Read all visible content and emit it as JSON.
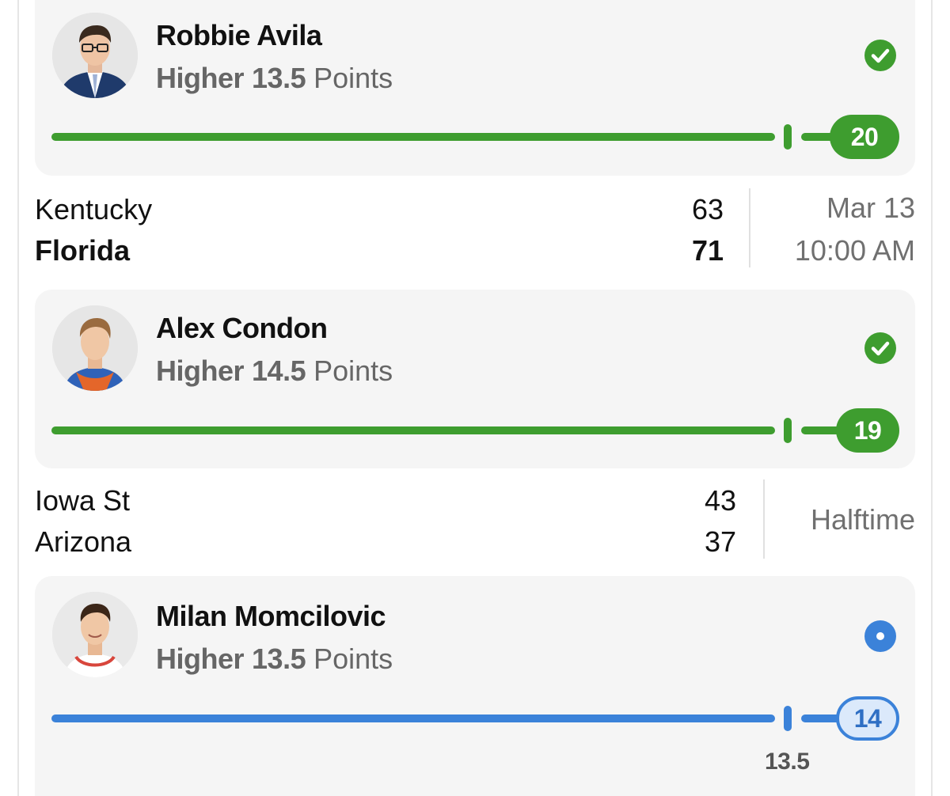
{
  "colors": {
    "success": "#3e9d2f",
    "in_progress": "#3b82d9",
    "card_bg": "#f5f5f5",
    "muted_text": "#666666"
  },
  "picks": [
    {
      "player": "Robbie Avila",
      "direction": "Higher",
      "line": "13.5",
      "stat": "Points",
      "status_icon": "check-circle-icon",
      "current_value": "20",
      "progress_fraction": 1.0
    },
    {
      "player": "Alex Condon",
      "direction": "Higher",
      "line": "14.5",
      "stat": "Points",
      "status_icon": "check-circle-icon",
      "current_value": "19",
      "progress_fraction": 1.0
    },
    {
      "player": "Milan Momcilovic",
      "direction": "Higher",
      "line": "13.5",
      "stat": "Points",
      "status_icon": "live-dot-icon",
      "current_value": "14",
      "marker_label": "13.5",
      "progress_fraction": 1.0
    }
  ],
  "games": [
    {
      "team1": "Kentucky",
      "score1": "63",
      "team2": "Florida",
      "score2": "71",
      "winner": "team2",
      "date": "Mar 13",
      "time": "10:00 AM"
    },
    {
      "team1": "Iowa St",
      "score1": "43",
      "team2": "Arizona",
      "score2": "37",
      "status": "Halftime"
    }
  ]
}
